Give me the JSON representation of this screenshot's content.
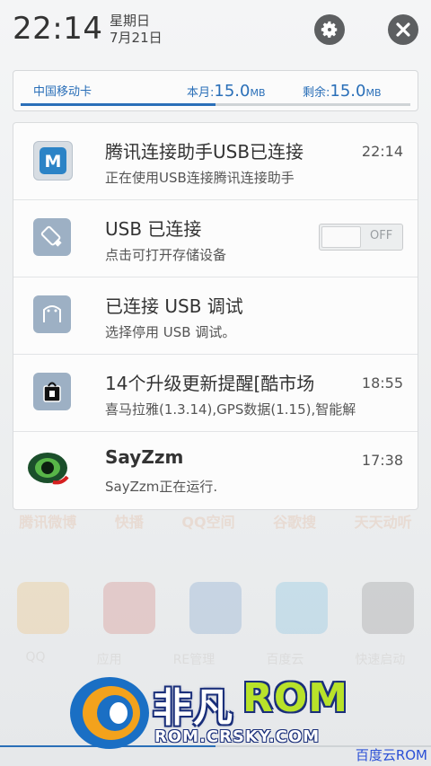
{
  "status": {
    "time": "22:14",
    "weekday": "星期日",
    "date": "7月21日"
  },
  "icons": {
    "settings": "gear-icon",
    "close": "close-icon"
  },
  "data_usage": {
    "carrier": "中国移动卡",
    "month_label": "本月:",
    "month_value": "15.0",
    "month_unit": "MB",
    "remain_label": "剩余:",
    "remain_value": "15.0",
    "remain_unit": "MB",
    "used_fraction": 0.5
  },
  "notifications": [
    {
      "title": "腾讯连接助手USB已连接",
      "subtitle": "正在使用USB连接腾讯连接助手",
      "time": "22:14",
      "icon": "tencent-assistant-icon"
    },
    {
      "title": "USB 已连接",
      "subtitle": "点击可打开存储设备",
      "toggle_label": "OFF",
      "toggle_on": false,
      "icon": "usb-icon"
    },
    {
      "title": "已连接 USB 调试",
      "subtitle": "选择停用 USB 调试。",
      "icon": "android-debug-icon"
    },
    {
      "title": "14个升级更新提醒[酷市场",
      "subtitle": "喜马拉雅(1.3.14),GPS数据(1.15),智能解",
      "time": "18:55",
      "icon": "shopping-bag-icon"
    },
    {
      "title": "SayZzm",
      "subtitle": "SayZzm正在运行.",
      "time": "17:38",
      "icon": "sayzzm-eye-icon"
    }
  ],
  "background": {
    "labels": [
      "腾讯微博",
      "快播",
      "QQ空间",
      "谷歌搜",
      "天天动听"
    ],
    "apps": [
      "QQ",
      "应用",
      "RE管理",
      "百度云",
      "快速启动"
    ]
  },
  "watermark": {
    "title_part1": "非凡",
    "title_part2": "ROM",
    "url": "ROM.CRSKY.COM",
    "corner": "百度云ROM"
  },
  "colors": {
    "accent": "#2a6fb8",
    "icon_dark": "#5d5f61"
  }
}
